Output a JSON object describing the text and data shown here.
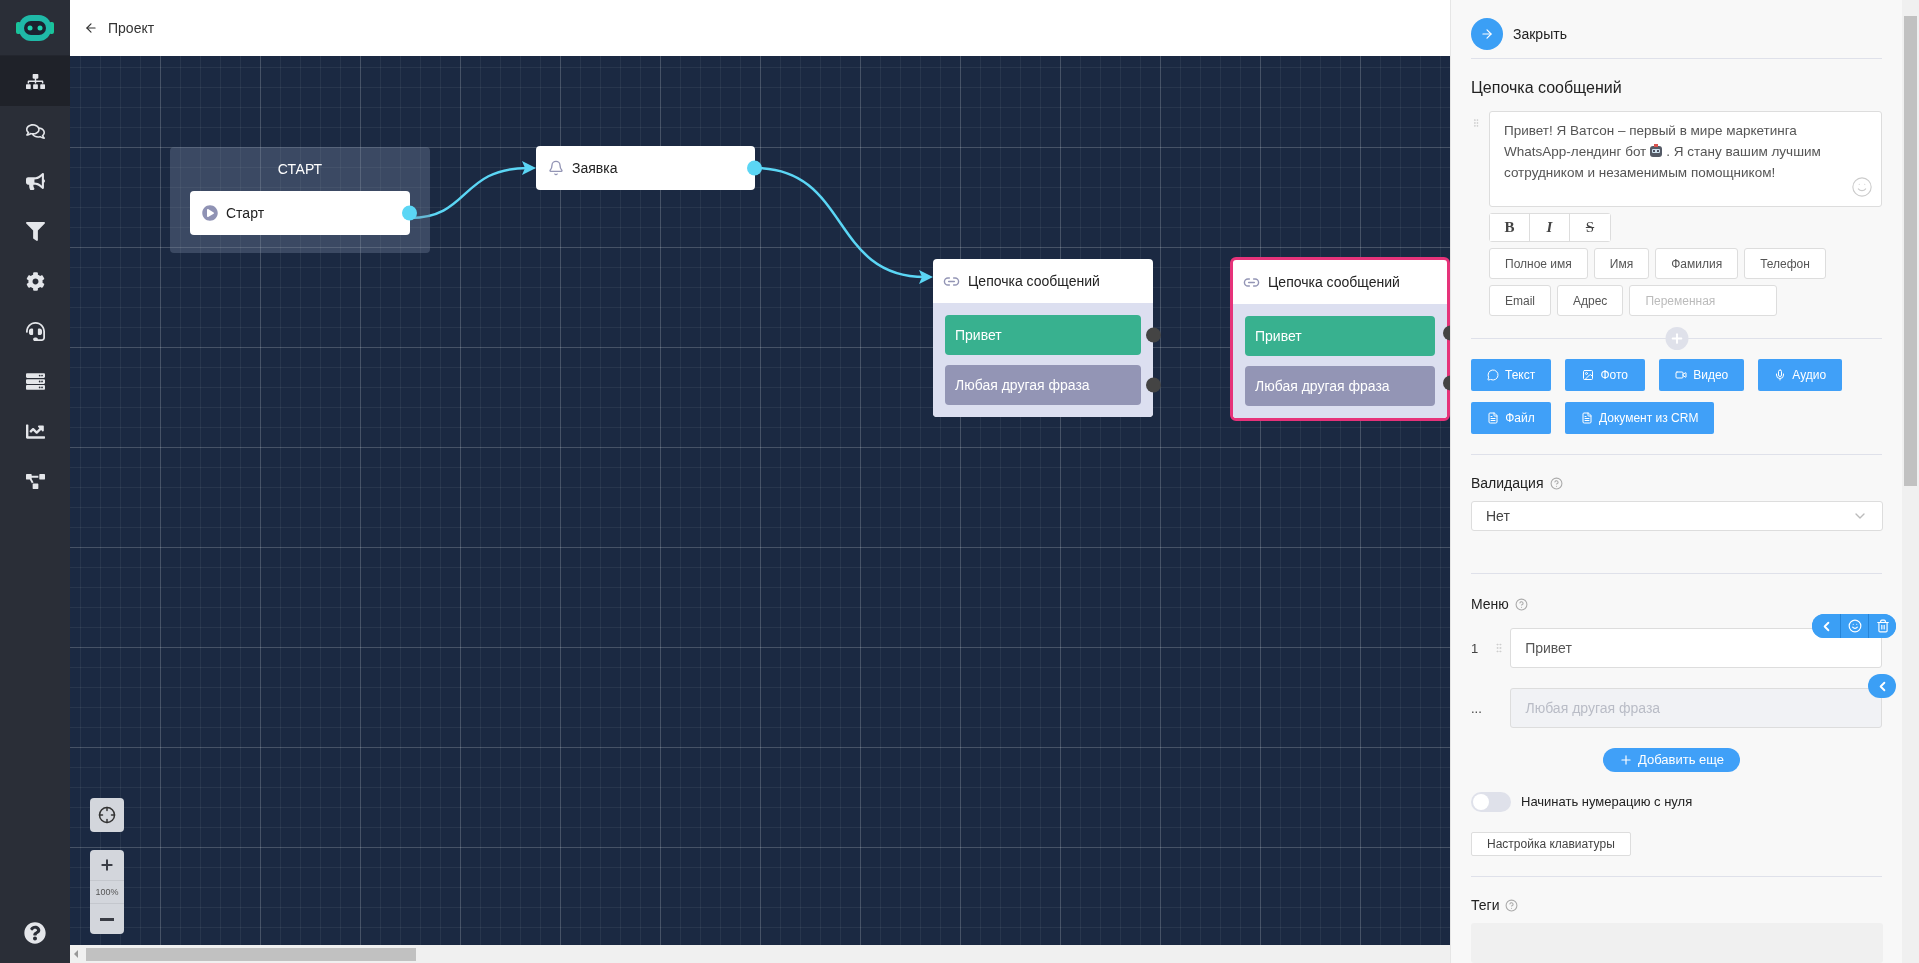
{
  "topbar": {
    "back_label": "Проект"
  },
  "sidebar": {
    "items": [
      {
        "selected": true
      },
      {
        "selected": false
      },
      {
        "selected": false
      },
      {
        "selected": false
      },
      {
        "selected": false
      },
      {
        "selected": false
      },
      {
        "selected": false
      },
      {
        "selected": false
      },
      {
        "selected": false
      }
    ]
  },
  "canvas": {
    "start_group": {
      "title": "СТАРТ",
      "node": {
        "label": "Старт"
      }
    },
    "nodes": [
      {
        "kind": "trigger",
        "label": "Заявка",
        "selected": false
      },
      {
        "kind": "chain",
        "label": "Цепочка сообщений",
        "selected": false,
        "rows": [
          {
            "kind": "option",
            "label": "Привет"
          },
          {
            "kind": "fallback",
            "label": "Любая другая фраза"
          }
        ]
      },
      {
        "kind": "chain",
        "label": "Цепочка сообщений",
        "selected": true,
        "rows": [
          {
            "kind": "option",
            "label": "Привет"
          },
          {
            "kind": "fallback",
            "label": "Любая другая фраза"
          }
        ]
      }
    ],
    "zoom_label": "100%"
  },
  "panel": {
    "close_label": "Закрыть",
    "title": "Цепочка сообщений",
    "message": {
      "text_before": "Привет! Я Ватсон – первый в мире маркетинга WhatsApp-лендинг бот",
      "text_after": ". Я стану вашим лучшим сотрудником и незаменимым помощником!"
    },
    "format_buttons": [
      "B",
      "I",
      "S"
    ],
    "variables": [
      "Полное имя",
      "Имя",
      "Фамилия",
      "Телефон",
      "Email",
      "Адрес"
    ],
    "variable_input": {
      "placeholder": "Переменная"
    },
    "add_buttons": [
      "Текст",
      "Фото",
      "Видео",
      "Аудио",
      "Файл",
      "Документ из CRM"
    ],
    "validation": {
      "label": "Валидация",
      "value": "Нет"
    },
    "menu": {
      "label": "Меню",
      "items": [
        {
          "number": "1",
          "value": "Привет",
          "disabled": false
        },
        {
          "number": "...",
          "placeholder": "Любая другая фраза",
          "disabled": true
        }
      ],
      "add_label": "Добавить еще"
    },
    "zero_numbering": {
      "label": "Начинать нумерацию с нуля",
      "on": false
    },
    "keyboard_button": "Настройка клавиатуры",
    "tags": {
      "label": "Теги"
    }
  }
}
